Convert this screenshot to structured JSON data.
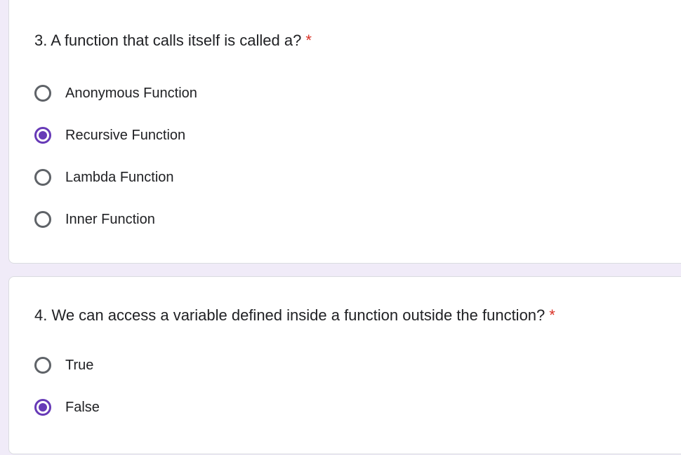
{
  "questions": [
    {
      "number_title": "3. A function that calls itself is called a?",
      "required_mark": "*",
      "options": [
        {
          "label": "Anonymous Function",
          "selected": false
        },
        {
          "label": "Recursive Function",
          "selected": true
        },
        {
          "label": "Lambda Function",
          "selected": false
        },
        {
          "label": "Inner Function",
          "selected": false
        }
      ]
    },
    {
      "number_title": "4. We can access a variable defined inside a function outside the function?",
      "required_mark": "*",
      "options": [
        {
          "label": "True",
          "selected": false
        },
        {
          "label": "False",
          "selected": true
        }
      ]
    }
  ],
  "colors": {
    "page_background": "#f0ebf8",
    "card_background": "#ffffff",
    "accent": "#673ab7",
    "required": "#d93025",
    "radio_unchecked": "#5f6368",
    "text": "#202124"
  }
}
